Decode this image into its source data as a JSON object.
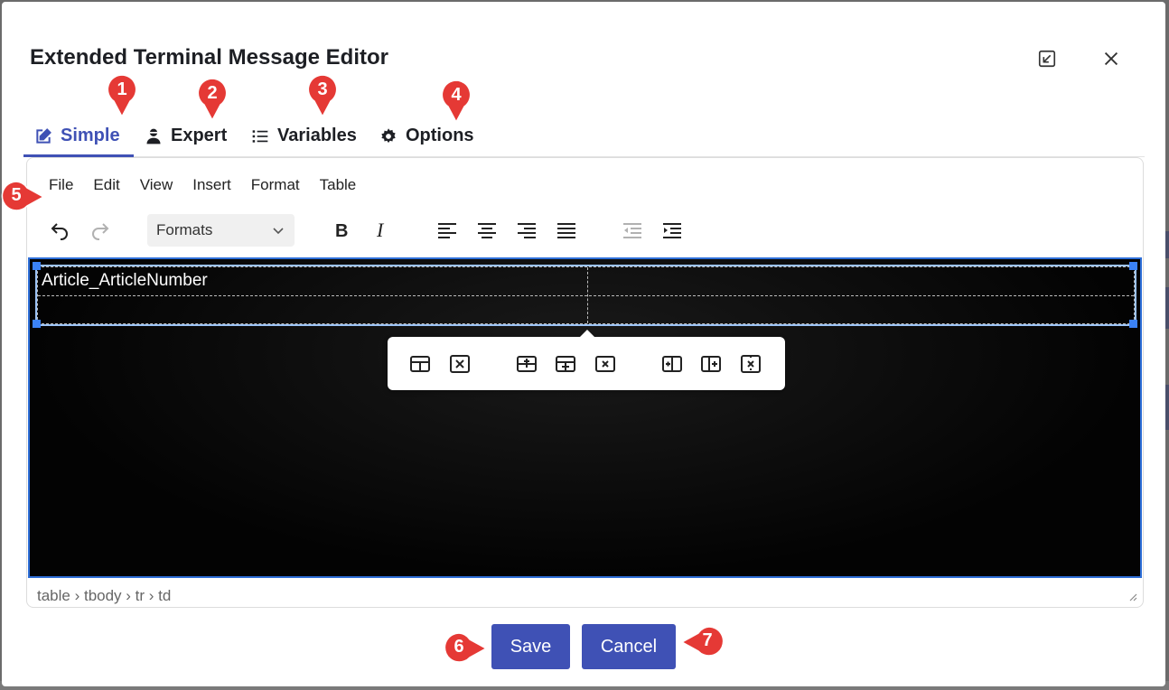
{
  "dialog": {
    "title": "Extended Terminal Message Editor",
    "header_icons": [
      "minimize-window-icon",
      "close-icon"
    ]
  },
  "tabs": [
    {
      "label": "Simple",
      "icon": "edit-icon",
      "active": true
    },
    {
      "label": "Expert",
      "icon": "user-tie-icon",
      "active": false
    },
    {
      "label": "Variables",
      "icon": "list-icon",
      "active": false
    },
    {
      "label": "Options",
      "icon": "gear-icon",
      "active": false
    }
  ],
  "editor": {
    "menu": [
      "File",
      "Edit",
      "View",
      "Insert",
      "Format",
      "Table"
    ],
    "formats_label": "Formats",
    "toolbar_icons": [
      "undo-icon",
      "redo-icon",
      "bold-icon",
      "italic-icon",
      "align-left-icon",
      "align-center-icon",
      "align-right-icon",
      "align-justify-icon",
      "outdent-icon",
      "indent-icon"
    ],
    "cell_text": "Article_ArticleNumber",
    "table_popup_icons": [
      "table-props-icon",
      "delete-table-icon",
      "insert-row-before-icon",
      "insert-row-after-icon",
      "delete-row-icon",
      "insert-col-before-icon",
      "insert-col-after-icon",
      "delete-col-icon"
    ],
    "status_path": "table › tbody › tr › td"
  },
  "footer": {
    "save_label": "Save",
    "cancel_label": "Cancel"
  },
  "markers": [
    "1",
    "2",
    "3",
    "4",
    "5",
    "6",
    "7"
  ],
  "colors": {
    "accent": "#3f51b5",
    "marker_red": "#e53935",
    "editor_bg": "#050505",
    "selection_blue": "#3b82f6"
  }
}
